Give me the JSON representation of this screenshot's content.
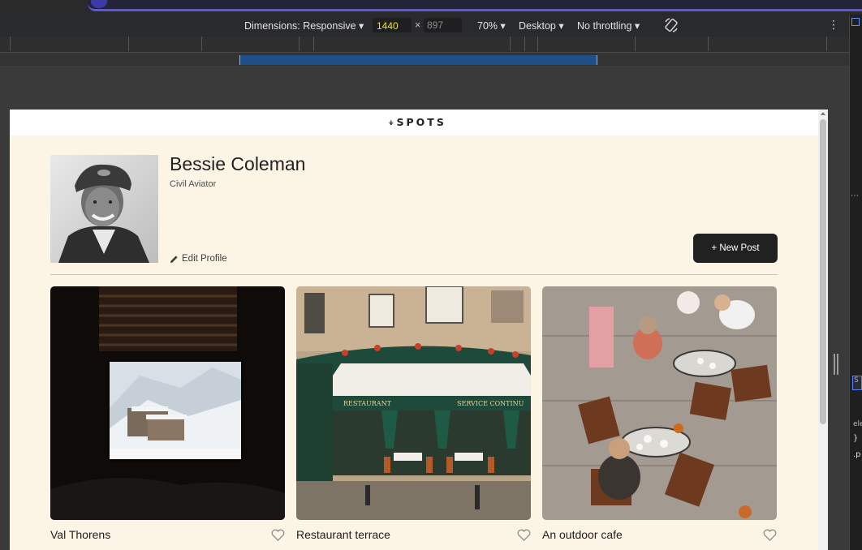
{
  "devtools": {
    "dimensions_label": "Dimensions: Responsive ▾",
    "width_value": "1440",
    "height_value": "897",
    "times": "×",
    "zoom": "70% ▾",
    "device_type": "Desktop ▾",
    "throttling": "No throttling ▾",
    "more": "⋮"
  },
  "site": {
    "logo": "⍖SPOTS",
    "profile": {
      "name": "Bessie Coleman",
      "description": "Civil Aviator",
      "edit_label": "Edit Profile"
    },
    "new_post_label": "+ New Post",
    "cards": [
      {
        "title": "Val Thorens"
      },
      {
        "title": "Restaurant terrace"
      },
      {
        "title": "An outdoor cafe"
      }
    ]
  },
  "colors": {
    "page_bg": "#fcf5e5",
    "button_bg": "#212121",
    "text": "#212121",
    "devtools_bg": "#292a2d",
    "width_highlight": "#f5e400"
  }
}
